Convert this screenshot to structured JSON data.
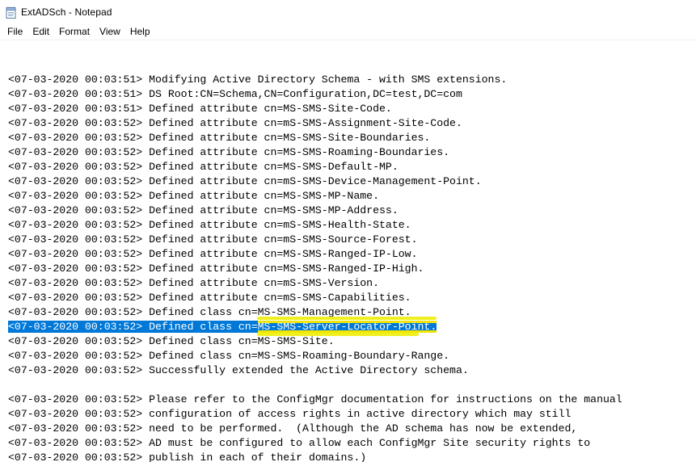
{
  "window": {
    "title": "ExtADSch - Notepad",
    "icon": "notepad-icon"
  },
  "menu": {
    "items": [
      "File",
      "Edit",
      "Format",
      "View",
      "Help"
    ]
  },
  "editor": {
    "lines": [
      "<07-03-2020 00:03:51> Modifying Active Directory Schema - with SMS extensions.",
      "<07-03-2020 00:03:51> DS Root:CN=Schema,CN=Configuration,DC=test,DC=com",
      "<07-03-2020 00:03:51> Defined attribute cn=MS-SMS-Site-Code.",
      "<07-03-2020 00:03:52> Defined attribute cn=mS-SMS-Assignment-Site-Code.",
      "<07-03-2020 00:03:52> Defined attribute cn=MS-SMS-Site-Boundaries.",
      "<07-03-2020 00:03:52> Defined attribute cn=MS-SMS-Roaming-Boundaries.",
      "<07-03-2020 00:03:52> Defined attribute cn=MS-SMS-Default-MP.",
      "<07-03-2020 00:03:52> Defined attribute cn=mS-SMS-Device-Management-Point.",
      "<07-03-2020 00:03:52> Defined attribute cn=MS-SMS-MP-Name.",
      "<07-03-2020 00:03:52> Defined attribute cn=MS-SMS-MP-Address.",
      "<07-03-2020 00:03:52> Defined attribute cn=mS-SMS-Health-State.",
      "<07-03-2020 00:03:52> Defined attribute cn=mS-SMS-Source-Forest.",
      "<07-03-2020 00:03:52> Defined attribute cn=MS-SMS-Ranged-IP-Low.",
      "<07-03-2020 00:03:52> Defined attribute cn=MS-SMS-Ranged-IP-High.",
      "<07-03-2020 00:03:52> Defined attribute cn=mS-SMS-Version.",
      "<07-03-2020 00:03:52> Defined attribute cn=mS-SMS-Capabilities.",
      "<07-03-2020 00:03:52> Defined class cn=MS-SMS-Management-Point.",
      "<07-03-2020 00:03:52> Defined class cn=MS-SMS-Server-Locator-Point.",
      "<07-03-2020 00:03:52> Defined class cn=MS-SMS-Site.",
      "<07-03-2020 00:03:52> Defined class cn=MS-SMS-Roaming-Boundary-Range.",
      "<07-03-2020 00:03:52> Successfully extended the Active Directory schema.",
      "",
      "<07-03-2020 00:03:52> Please refer to the ConfigMgr documentation for instructions on the manual",
      "<07-03-2020 00:03:52> configuration of access rights in active directory which may still",
      "<07-03-2020 00:03:52> need to be performed.  (Although the AD schema has now be extended,",
      "<07-03-2020 00:03:52> AD must be configured to allow each ConfigMgr Site security rights to",
      "<07-03-2020 00:03:52> publish in each of their domains.)"
    ],
    "selected_line_index": 17,
    "highlight_part_a": "<07-03-2020 00:03:52> Defined class cn=",
    "highlight_part_b": "MS-SMS-Server-Locator-Point."
  },
  "colors": {
    "selection": "#0078d7",
    "marker": "#f2e600"
  }
}
